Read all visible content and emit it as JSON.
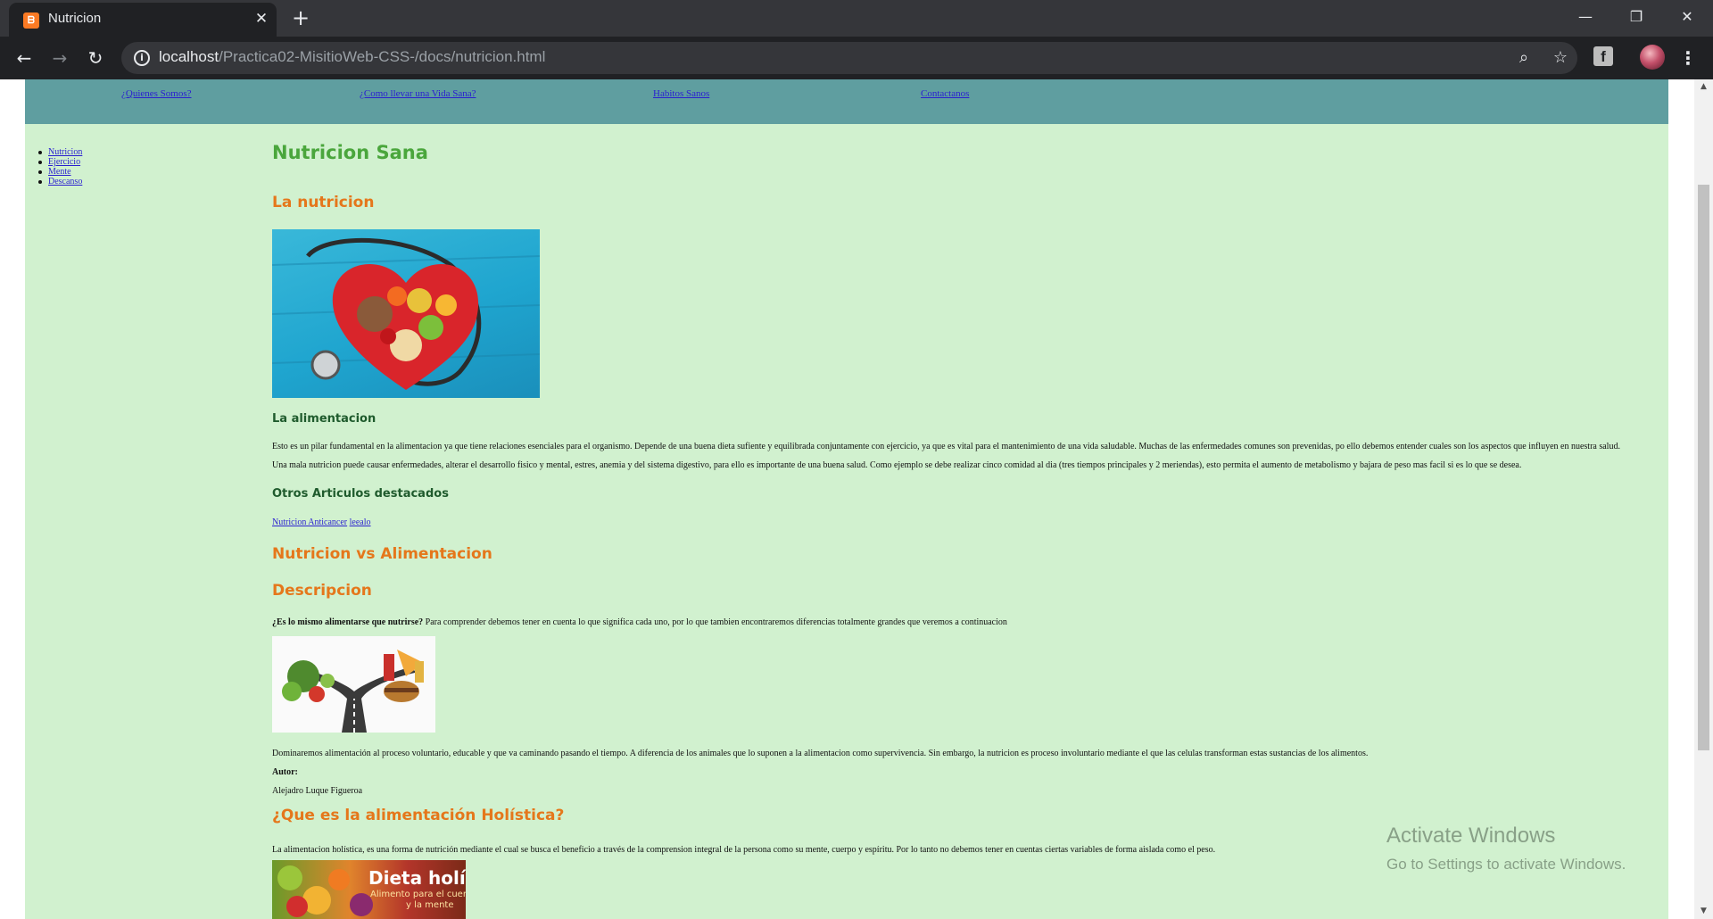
{
  "browser": {
    "tab_title": "Nutricion",
    "tab_close": "✕",
    "new_tab": "+",
    "url_host": "localhost",
    "url_path": "/Practica02-MisitioWeb-CSS-/docs/nutricion.html",
    "window_controls": {
      "minimize": "—",
      "maximize": "❐",
      "close": "✕"
    },
    "extension_label": "f"
  },
  "topnav": {
    "items": [
      "¿Quienes Somos?",
      "¿Como llevar una Vida Sana?",
      "Habitos Sanos",
      "Contactanos"
    ]
  },
  "sidenav": {
    "items": [
      "Nutricion",
      "Ejercicio",
      "Mente",
      "Descanso"
    ]
  },
  "article": {
    "page_heading": "Nutricion Sana",
    "section1_heading": "La nutricion",
    "alimentacion_heading": "La alimentacion",
    "para1": "Esto es un pilar fundamental en la alimentacion ya que tiene relaciones esenciales para el organismo. Depende de una buena dieta sufiente y equilibrada conjuntamente con ejercicio, ya que es vital para el mantenimiento de una vida saludable. Muchas de las enfermedades comunes son prevenidas, po ello debemos entender cuales son los aspectos que influyen en nuestra salud.",
    "para2": "Una mala nutricion puede causar enfermedades, alterar el desarrollo fisico y mental, estres, anemia y del sistema digestivo, para ello es importante de una buena salud. Como ejemplo se debe realizar cinco comidad al dia (tres tiempos principales y 2 meriendas), esto permita el aumento de metabolismo y bajara de peso mas facil si es lo que se desea.",
    "otros_heading": "Otros Articulos destacados",
    "links": [
      "Nutricion Anticancer",
      "leealo"
    ],
    "vs_heading": "Nutricion vs Alimentacion",
    "descripcion_heading": "Descripcion",
    "question_bold": "¿Es lo mismo alimentarse que nutrirse?",
    "question_rest": " Para comprender debemos tener en cuenta lo que significa cada uno, por lo que tambien encontraremos diferencias totalmente grandes que veremos a continuacion",
    "para3": "Dominaremos alimentación al proceso voluntario, educable y que va caminando pasando el tiempo. A diferencia de los animales que lo suponen a la alimentacion como supervivencia. Sin embargo, la nutricion es proceso involuntario mediante el que las celulas transforman estas sustancias de los alimentos.",
    "autor_label": "Autor:",
    "autor_name": "Alejadro Luque Figueroa",
    "holistica_heading": "¿Que es la alimentación Holística?",
    "para4": "La alimentacion holística, es una forma de nutrición mediante el cual se busca el beneficio a través de la comprension integral de la persona como su mente, cuerpo y espíritu. Por lo tanto no debemos tener en cuentas ciertas variables de forma aislada como el peso.",
    "holistic_image_title": "Dieta holística",
    "holistic_image_subtitle1": "Alimento para el cuerpo",
    "holistic_image_subtitle2": "y la mente"
  },
  "watermark": {
    "title": "Activate Windows",
    "subtitle": "Go to Settings to activate Windows."
  }
}
